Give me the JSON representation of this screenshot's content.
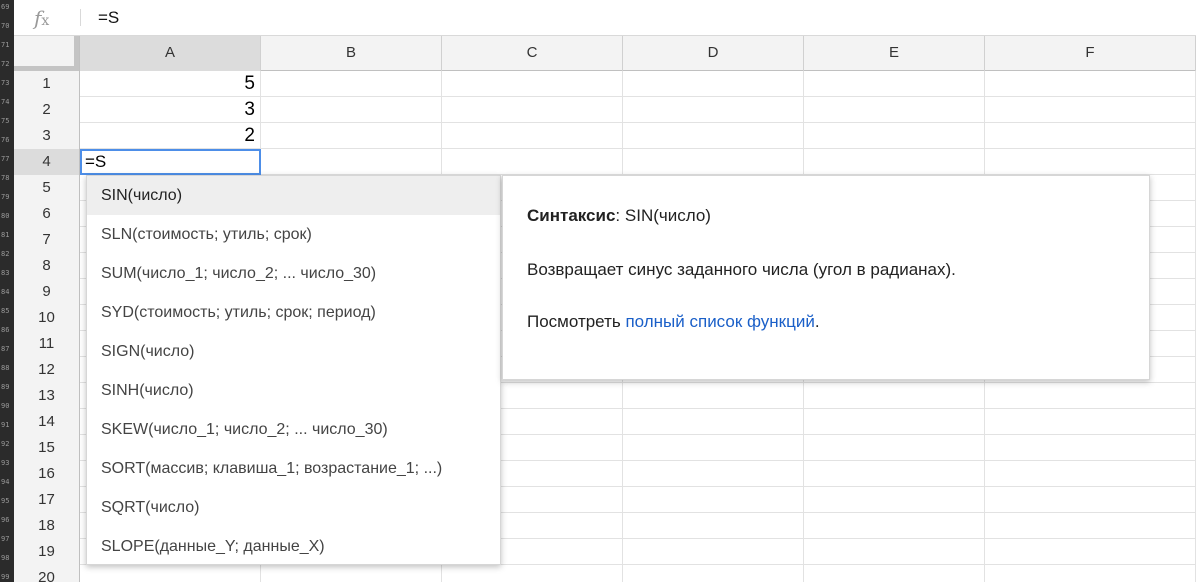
{
  "gutter_numbers": [
    "69",
    "70",
    "71",
    "72",
    "73",
    "74",
    "75",
    "76",
    "77",
    "78",
    "79",
    "80",
    "81",
    "82",
    "83",
    "84",
    "85",
    "86",
    "87",
    "88",
    "89",
    "90",
    "91",
    "92",
    "93",
    "94",
    "95",
    "96",
    "97",
    "98",
    "99"
  ],
  "formula_bar": {
    "fx_icon": "fx-icon",
    "text": "=S"
  },
  "columns": [
    "A",
    "B",
    "C",
    "D",
    "E",
    "F"
  ],
  "selected_column": "A",
  "rows": [
    "1",
    "2",
    "3",
    "4",
    "5",
    "6",
    "7",
    "8",
    "9",
    "10",
    "11",
    "12",
    "13",
    "14",
    "15",
    "16",
    "17",
    "18",
    "19",
    "20"
  ],
  "selected_row": "4",
  "cells": {
    "A1": "5",
    "A2": "3",
    "A3": "2",
    "A4": "=S"
  },
  "autocomplete": {
    "items": [
      "SIN(число)",
      "SLN(стоимость; утиль; срок)",
      "SUM(число_1; число_2; ... число_30)",
      "SYD(стоимость; утиль; срок; период)",
      "SIGN(число)",
      "SINH(число)",
      "SKEW(число_1; число_2; ... число_30)",
      "SORT(массив; клавиша_1; возрастание_1; ...)",
      "SQRT(число)",
      "SLOPE(данные_Y; данные_X)"
    ],
    "selected_index": 0
  },
  "help": {
    "syntax_label": "Синтаксис",
    "syntax_sep": ":",
    "syntax_value": "SIN(число)",
    "description": "Возвращает синус заданного числа (угол в радианах).",
    "see_prefix": "Посмотреть",
    "see_link": "полный список функций",
    "see_suffix": ".",
    "link_color": "#1a5fc8"
  },
  "colors": {
    "selection_border": "#4d8ee8",
    "header_bg": "#f3f3f3",
    "header_selected_bg": "#dcdcdc"
  }
}
